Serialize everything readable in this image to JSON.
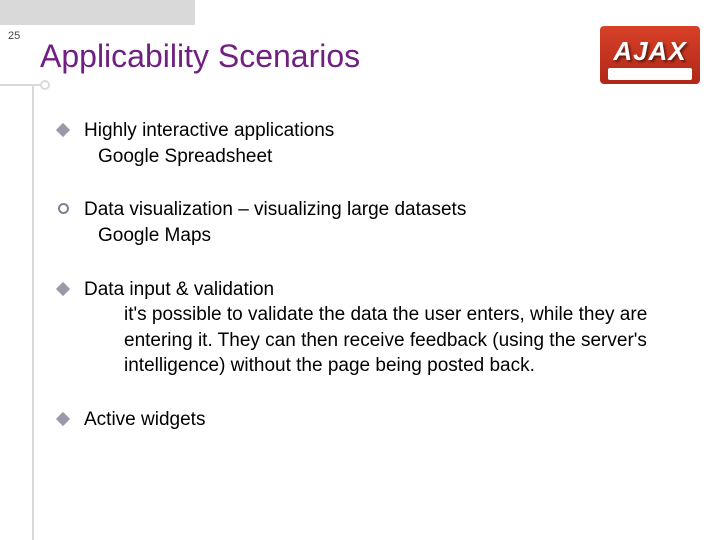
{
  "slide_number": "25",
  "title": "Applicability Scenarios",
  "logo": {
    "text": "AJAX"
  },
  "items": [
    {
      "bullet": "diamond",
      "text": "Highly interactive applications",
      "sub": "Google Spreadsheet"
    },
    {
      "bullet": "circle",
      "text": "Data visualization – visualizing large datasets",
      "sub": "Google Maps"
    },
    {
      "bullet": "diamond",
      "text": "Data input & validation",
      "sub_indent": "it's possible to validate the data the user enters, while they are entering it. They can then receive feedback (using the server's intelligence) without the page being posted back."
    },
    {
      "bullet": "diamond",
      "text": "Active widgets"
    }
  ]
}
